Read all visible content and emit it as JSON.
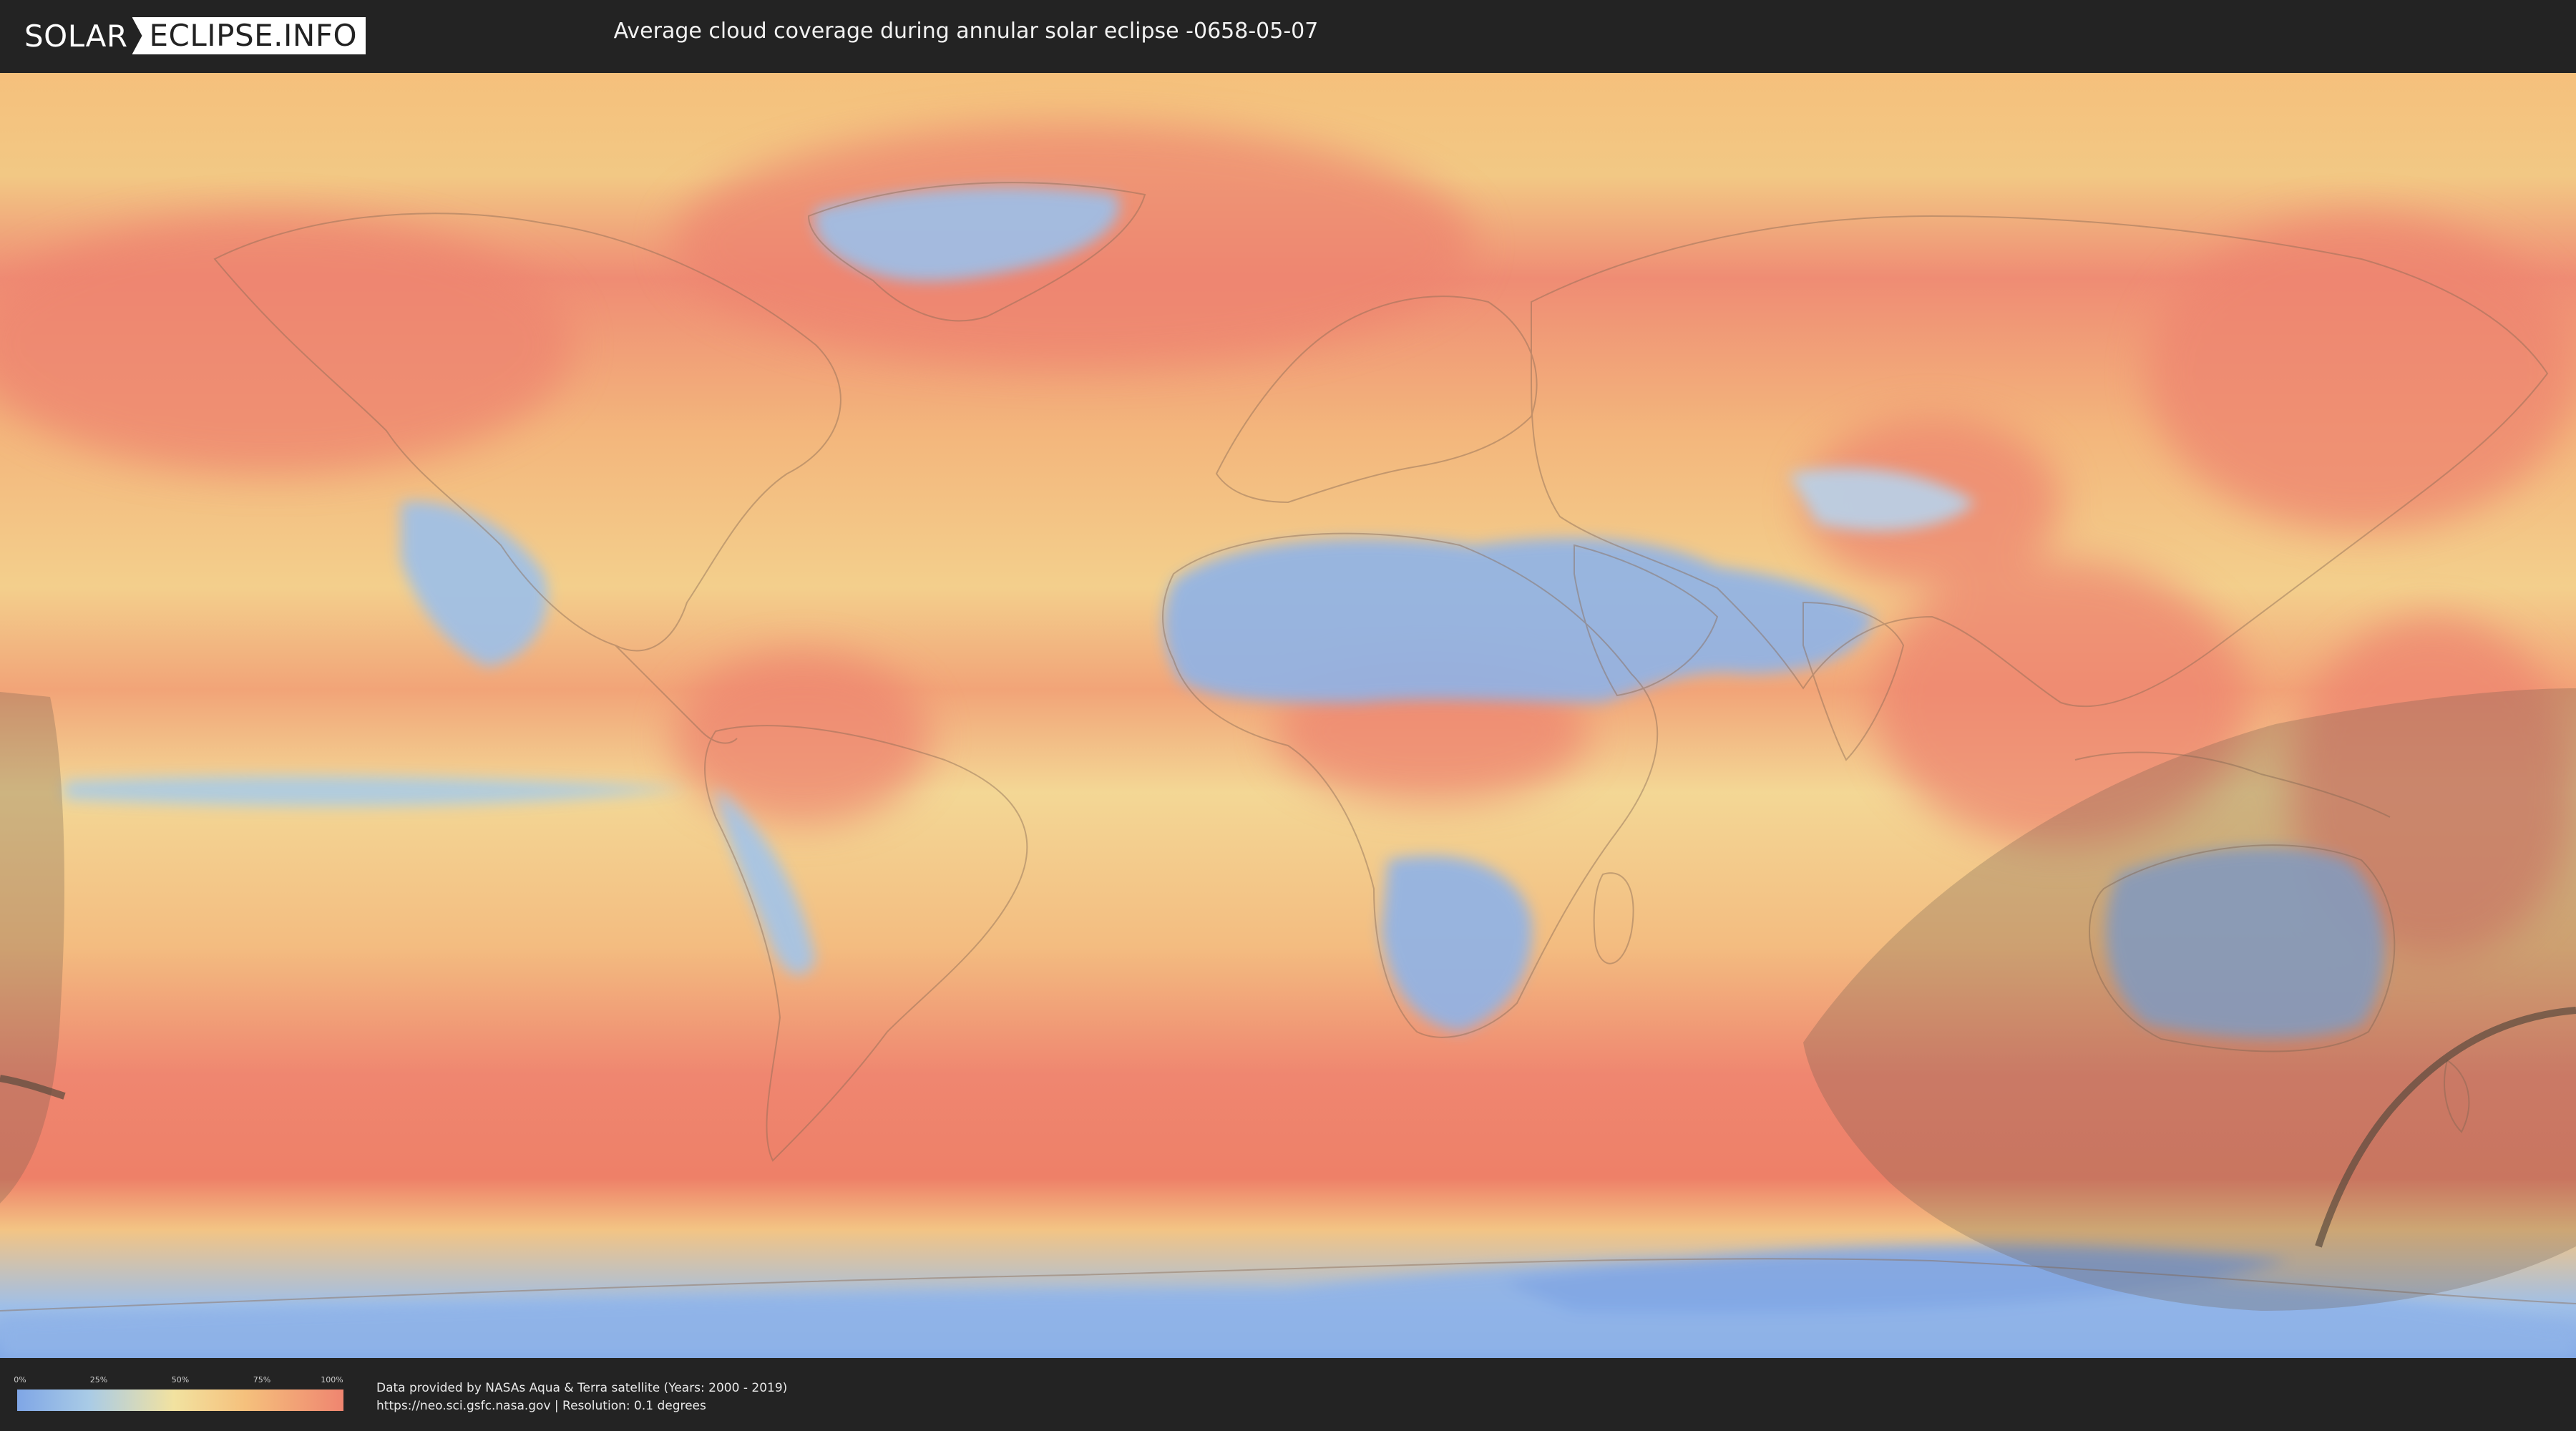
{
  "header": {
    "logo_solar": "SOLAR",
    "logo_rest": "ECLIPSE.INFO",
    "title": "Average cloud coverage during annular solar eclipse -0658-05-07"
  },
  "map": {
    "colors": {
      "clear": "#7fa6e6",
      "low": "#a9cbe6",
      "mid": "#f2e2a0",
      "high": "#f5c07c",
      "overcast": "#ef8570",
      "eclipse_shadow": "#6b5a4a"
    }
  },
  "legend": {
    "ticks": [
      "0%",
      "25%",
      "50%",
      "75%",
      "100%"
    ]
  },
  "credits": {
    "line1": "Data provided by NASAs Aqua & Terra satellite (Years: 2000 - 2019)",
    "line2": "https://neo.sci.gsfc.nasa.gov | Resolution: 0.1 degrees"
  }
}
